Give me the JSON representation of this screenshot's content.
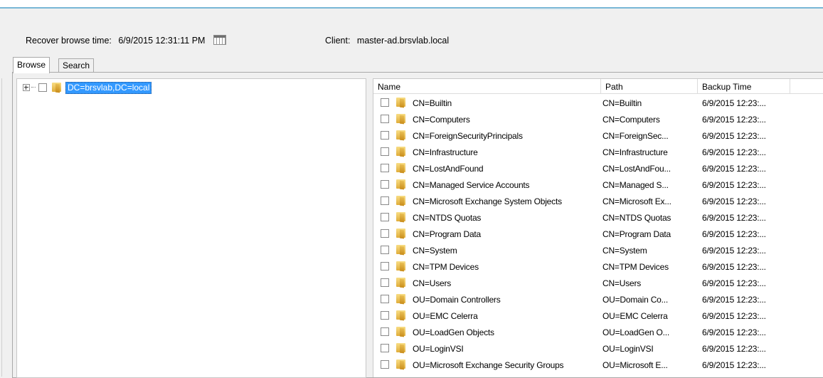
{
  "header": {
    "recover_label": "Recover browse time:",
    "recover_value": "6/9/2015 12:31:11 PM",
    "client_label": "Client:",
    "client_value": "master-ad.brsvlab.local"
  },
  "tabs": [
    {
      "label": "Browse",
      "active": true
    },
    {
      "label": "Search",
      "active": false
    }
  ],
  "tree": {
    "root_label": "DC=brsvlab,DC=local"
  },
  "list": {
    "columns": [
      "Name",
      "Path",
      "Backup Time"
    ],
    "rows": [
      {
        "name": "CN=Builtin",
        "path": "CN=Builtin",
        "time": "6/9/2015 12:23:..."
      },
      {
        "name": "CN=Computers",
        "path": "CN=Computers",
        "time": "6/9/2015 12:23:..."
      },
      {
        "name": "CN=ForeignSecurityPrincipals",
        "path": "CN=ForeignSec...",
        "time": "6/9/2015 12:23:..."
      },
      {
        "name": "CN=Infrastructure",
        "path": "CN=Infrastructure",
        "time": "6/9/2015 12:23:..."
      },
      {
        "name": "CN=LostAndFound",
        "path": "CN=LostAndFou...",
        "time": "6/9/2015 12:23:..."
      },
      {
        "name": "CN=Managed Service Accounts",
        "path": "CN=Managed S...",
        "time": "6/9/2015 12:23:..."
      },
      {
        "name": "CN=Microsoft Exchange System Objects",
        "path": "CN=Microsoft Ex...",
        "time": "6/9/2015 12:23:..."
      },
      {
        "name": "CN=NTDS Quotas",
        "path": "CN=NTDS Quotas",
        "time": "6/9/2015 12:23:..."
      },
      {
        "name": "CN=Program Data",
        "path": "CN=Program Data",
        "time": "6/9/2015 12:23:..."
      },
      {
        "name": "CN=System",
        "path": "CN=System",
        "time": "6/9/2015 12:23:..."
      },
      {
        "name": "CN=TPM Devices",
        "path": "CN=TPM Devices",
        "time": "6/9/2015 12:23:..."
      },
      {
        "name": "CN=Users",
        "path": "CN=Users",
        "time": "6/9/2015 12:23:..."
      },
      {
        "name": "OU=Domain Controllers",
        "path": "OU=Domain Co...",
        "time": "6/9/2015 12:23:..."
      },
      {
        "name": "OU=EMC Celerra",
        "path": "OU=EMC Celerra",
        "time": "6/9/2015 12:23:..."
      },
      {
        "name": "OU=LoadGen Objects",
        "path": "OU=LoadGen O...",
        "time": "6/9/2015 12:23:..."
      },
      {
        "name": "OU=LoginVSI",
        "path": "OU=LoginVSI",
        "time": "6/9/2015 12:23:..."
      },
      {
        "name": "OU=Microsoft Exchange Security Groups",
        "path": "OU=Microsoft E...",
        "time": "6/9/2015 12:23:..."
      }
    ]
  }
}
